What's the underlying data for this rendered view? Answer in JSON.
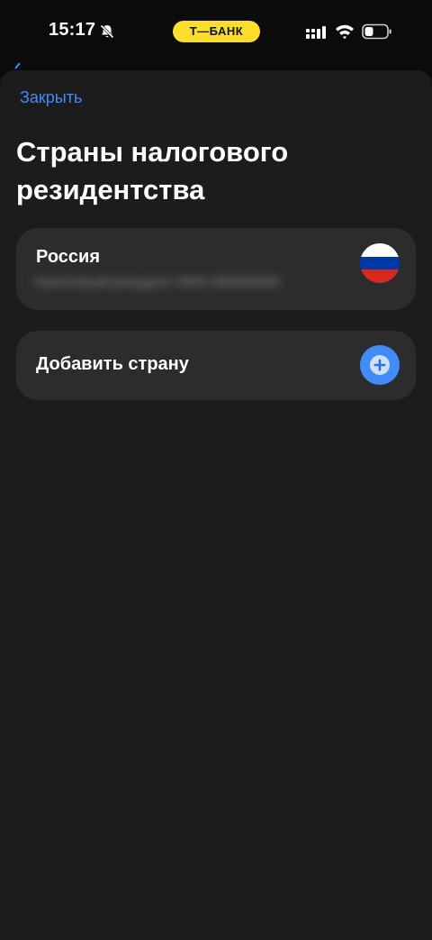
{
  "status_bar": {
    "time": "15:17",
    "carrier": "Т—БАНК",
    "icons": {
      "mute": "bell-slash-icon",
      "signal": "cellular-signal-icon",
      "wifi": "wifi-icon",
      "battery": "battery-low-icon"
    }
  },
  "sheet": {
    "close_label": "Закрыть",
    "title": "Страны налогового резидентства",
    "country_card": {
      "name": "Россия",
      "subtitle_redacted": "Налоговый резидент  ИНН 000000000000",
      "flag": "russia-flag-icon",
      "flag_colors": [
        "#ffffff",
        "#0039a6",
        "#d52b1e"
      ]
    },
    "add_card": {
      "label": "Добавить страну",
      "icon": "add-circle-icon"
    }
  },
  "colors": {
    "accent": "#428bf9",
    "sheet_background": "#1c1c1e",
    "card_background": "#2c2c2e",
    "carrier_pill": "#ffdd2d"
  }
}
